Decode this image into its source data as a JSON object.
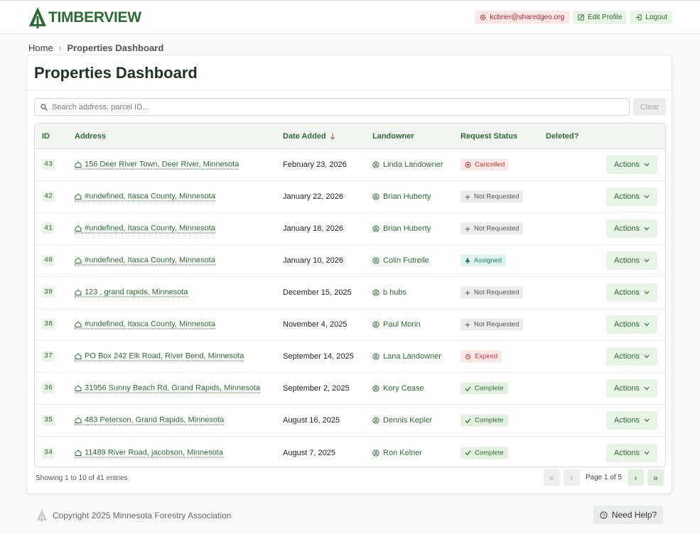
{
  "brand": {
    "name": "TIMBERVIEW",
    "color": "#2e6b34"
  },
  "header": {
    "user_email": "kcbrier@sharedgeo.org",
    "edit_profile_label": "Edit Profile",
    "logout_label": "Logout"
  },
  "breadcrumb": {
    "home": "Home",
    "current": "Properties Dashboard"
  },
  "page": {
    "title": "Properties Dashboard"
  },
  "search": {
    "placeholder": "Search address, parcel ID...",
    "value": "",
    "clear_label": "Clear"
  },
  "table": {
    "columns": [
      "ID",
      "Address",
      "Date Added",
      "Landowner",
      "Request Status",
      "Deleted?"
    ],
    "sort": {
      "column": "Date Added",
      "direction": "descending"
    },
    "action_label": "Actions",
    "rows": [
      {
        "id": "43",
        "address": "156 Deer River Town, Deer River, Minnesota",
        "date": "February 23, 2026",
        "landowner": "Linda Landowner",
        "status": "Cancelled",
        "status_type": "cancelled",
        "deleted": ""
      },
      {
        "id": "42",
        "address": "#undefined, Itasca County, Minnesota",
        "date": "January 22, 2026",
        "landowner": "Brian Huberty",
        "status": "Not Requested",
        "status_type": "not-requested",
        "deleted": ""
      },
      {
        "id": "41",
        "address": "#undefined, Itasca County, Minnesota",
        "date": "January 18, 2026",
        "landowner": "Brian Huberty",
        "status": "Not Requested",
        "status_type": "not-requested",
        "deleted": ""
      },
      {
        "id": "40",
        "address": "#undefined, Itasca County, Minnesota",
        "date": "January 10, 2026",
        "landowner": "Colin Futrelle",
        "status": "Assigned",
        "status_type": "assigned",
        "deleted": ""
      },
      {
        "id": "39",
        "address": "123 , grand rapids, Minnesota",
        "date": "December 15, 2025",
        "landowner": "b hubs",
        "status": "Not Requested",
        "status_type": "not-requested",
        "deleted": ""
      },
      {
        "id": "38",
        "address": "#undefined, Itasca County, Minnesota",
        "date": "November 4, 2025",
        "landowner": "Paul Morin",
        "status": "Not Requested",
        "status_type": "not-requested",
        "deleted": ""
      },
      {
        "id": "37",
        "address": "PO Box 242 Elk Road, River Bend, Minnesota",
        "date": "September 14, 2025",
        "landowner": "Lana Landowner",
        "status": "Expired",
        "status_type": "expired",
        "deleted": ""
      },
      {
        "id": "36",
        "address": "31956 Sunny Beach Rd, Grand Rapids, Minnesota",
        "date": "September 2, 2025",
        "landowner": "Kory Cease",
        "status": "Complete",
        "status_type": "complete",
        "deleted": ""
      },
      {
        "id": "35",
        "address": "483 Peterson, Grand Rapids, Minnesota",
        "date": "August 16, 2025",
        "landowner": "Dennis Kepler",
        "status": "Complete",
        "status_type": "complete",
        "deleted": ""
      },
      {
        "id": "34",
        "address": "11489 River Road, jacobson, Minnesota",
        "date": "August 7, 2025",
        "landowner": "Ron Kelner",
        "status": "Complete",
        "status_type": "complete",
        "deleted": ""
      }
    ]
  },
  "status_styles": {
    "cancelled": {
      "bg": "#fde8e8",
      "fg": "#c0392b",
      "icon": "x-circle-icon"
    },
    "not-requested": {
      "bg": "#ececec",
      "fg": "#555555",
      "icon": "plus-icon"
    },
    "assigned": {
      "bg": "#dff3ef",
      "fg": "#1f7a66",
      "icon": "tree-icon"
    },
    "expired": {
      "bg": "#fde8e8",
      "fg": "#c0392b",
      "icon": "alarm-icon"
    },
    "complete": {
      "bg": "#e3f2e0",
      "fg": "#2e6b34",
      "icon": "check-icon"
    }
  },
  "pagination": {
    "summary": "Showing 1 to 10 of 41 entries",
    "page_label": "Page 1 of 5",
    "current_page": 1,
    "total_pages": 5
  },
  "footer": {
    "copyright": "Copyright 2025 Minnesota Forestry Association",
    "help_label": "Need Help?"
  }
}
